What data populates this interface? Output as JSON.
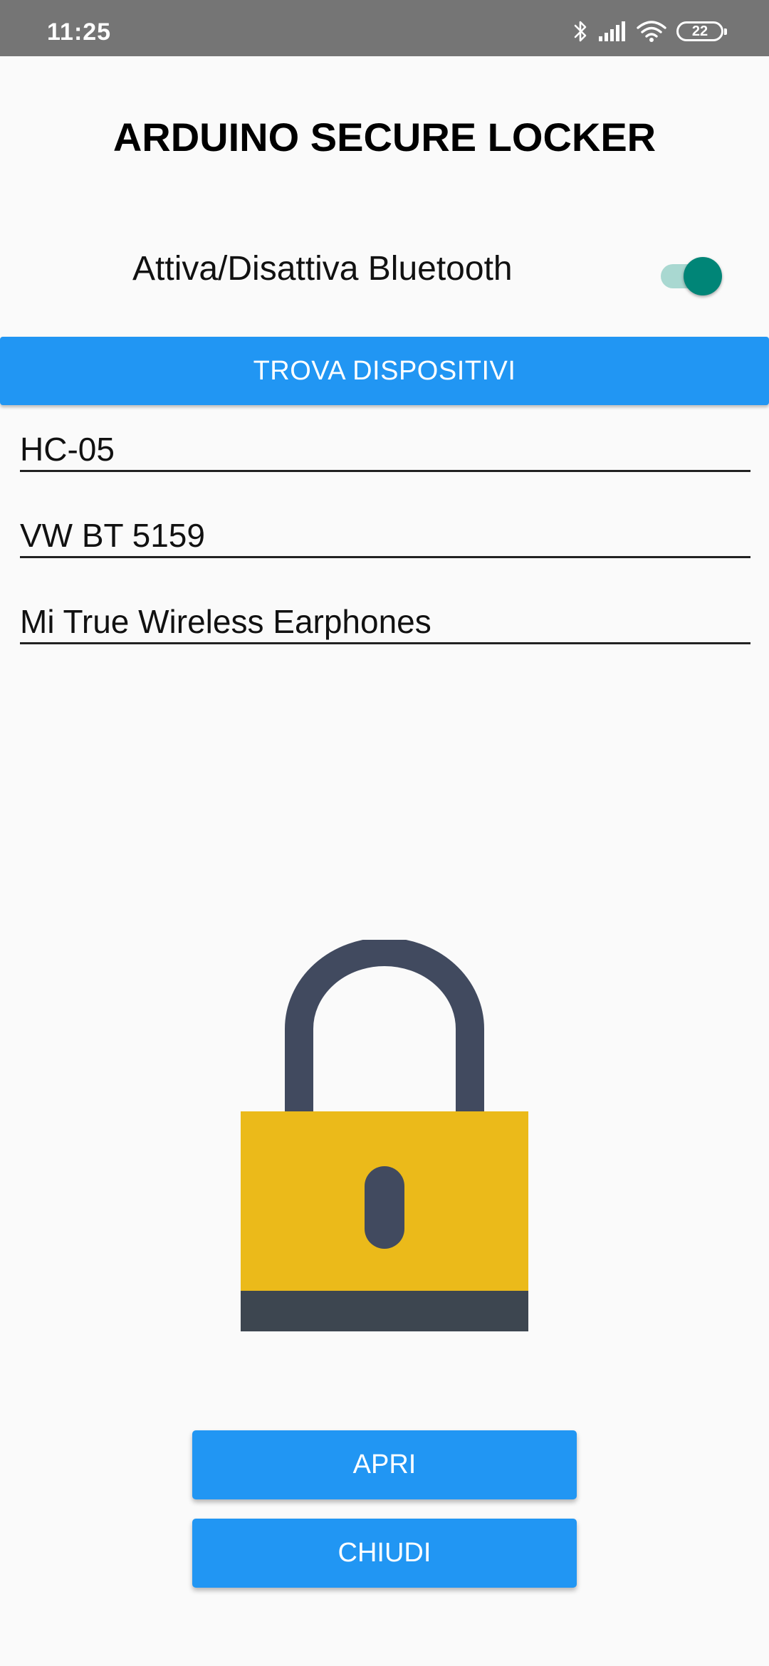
{
  "status_bar": {
    "time": "11:25",
    "battery_level": "22",
    "icons": [
      "bluetooth-icon",
      "signal-icon",
      "wifi-icon",
      "battery-icon"
    ]
  },
  "app": {
    "title": "ARDUINO SECURE LOCKER"
  },
  "bluetooth": {
    "label": "Attiva/Disattiva Bluetooth",
    "enabled": true
  },
  "find_button": {
    "label": "TROVA DISPOSITIVI"
  },
  "devices": [
    {
      "name": "HC-05"
    },
    {
      "name": "VW BT 5159"
    },
    {
      "name": "Mi True Wireless Earphones"
    }
  ],
  "lock": {
    "icon": "padlock-icon",
    "colors": {
      "shackle": "#414a5f",
      "body": "#ebba1a",
      "base": "#3d4650"
    }
  },
  "actions": {
    "open_label": "APRI",
    "close_label": "CHIUDI"
  },
  "colors": {
    "accent": "#2196f3",
    "switch_on": "#008577",
    "status_bar": "#757575"
  }
}
